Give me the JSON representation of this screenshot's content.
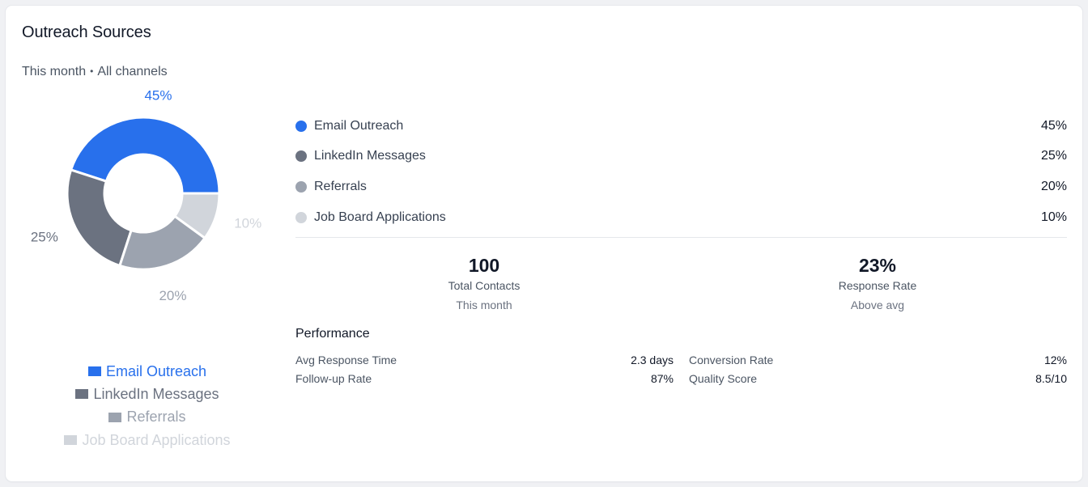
{
  "header": {
    "title": "Outreach Sources",
    "period": "This month",
    "separator": "•",
    "scope": "All channels"
  },
  "colors": {
    "email": "#2870ec",
    "linkedin": "#6b7280",
    "referrals": "#9ca3af",
    "job_board": "#d1d5db"
  },
  "chart_data": {
    "type": "pie",
    "categories": [
      "Email Outreach",
      "LinkedIn Messages",
      "Referrals",
      "Job Board Applications"
    ],
    "values": [
      45,
      25,
      20,
      10
    ],
    "data_labels": [
      "45%",
      "25%",
      "20%",
      "10%"
    ],
    "colors": [
      "#2870ec",
      "#6b7280",
      "#9ca3af",
      "#d1d5db"
    ],
    "legend_placement": "bottom"
  },
  "breakdown": {
    "items": [
      {
        "label": "Email Outreach",
        "value": "45%"
      },
      {
        "label": "LinkedIn Messages",
        "value": "25%"
      },
      {
        "label": "Referrals",
        "value": "20%"
      },
      {
        "label": "Job Board Applications",
        "value": "10%"
      }
    ]
  },
  "stats": {
    "contacts": {
      "value": "100",
      "label": "Total Contacts",
      "sub": "This month"
    },
    "response": {
      "value": "23%",
      "label": "Response Rate",
      "sub": "Above avg"
    }
  },
  "performance": {
    "title": "Performance",
    "metrics": [
      {
        "label": "Avg Response Time",
        "value": "2.3 days"
      },
      {
        "label": "Conversion Rate",
        "value": "12%"
      },
      {
        "label": "Follow-up Rate",
        "value": "87%"
      },
      {
        "label": "Quality Score",
        "value": "8.5/10"
      }
    ]
  }
}
